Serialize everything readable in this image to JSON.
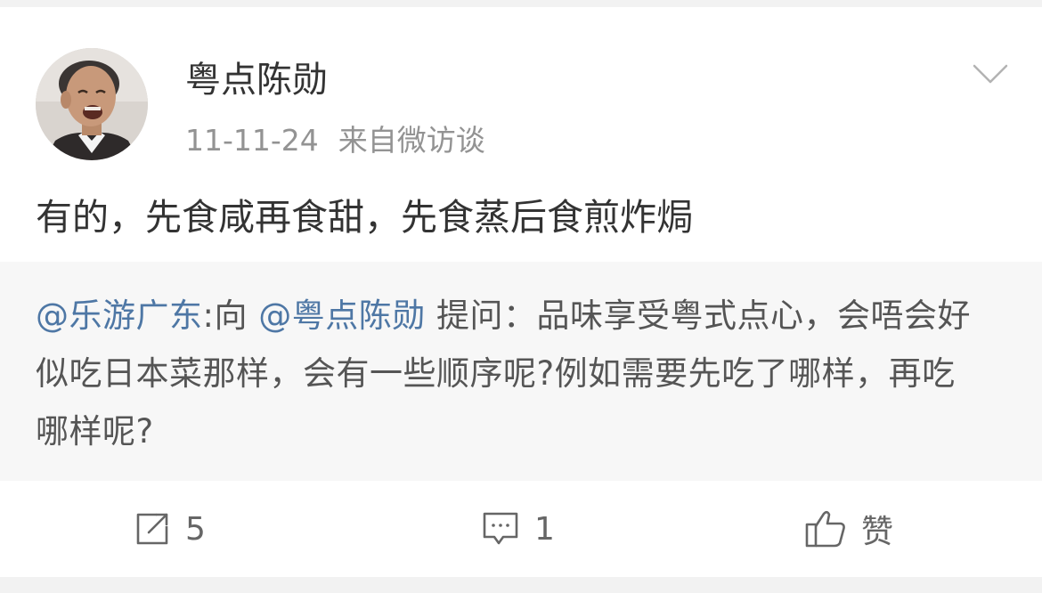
{
  "post": {
    "author": "粤点陈勋",
    "date": "11-11-24",
    "source": "来自微访谈",
    "text": "有的，先食咸再食甜，先食蒸后食煎炸焗"
  },
  "quote": {
    "asker_mention": "@乐游广东",
    "to_label": ":向",
    "target_mention": "@粤点陈勋",
    "question": "提问：品味享受粤式点心，会唔会好似吃日本菜那样，会有一些顺序呢?例如需要先吃了哪样，再吃哪样呢?"
  },
  "actions": {
    "repost_icon": "share-icon",
    "repost_count": "5",
    "comment_icon": "comment-icon",
    "comment_count": "1",
    "like_icon": "thumbs-up-icon",
    "like_label": "赞"
  },
  "colors": {
    "mention": "#4e77a5",
    "meta": "#939393",
    "quote_background": "#f7f7f7"
  }
}
